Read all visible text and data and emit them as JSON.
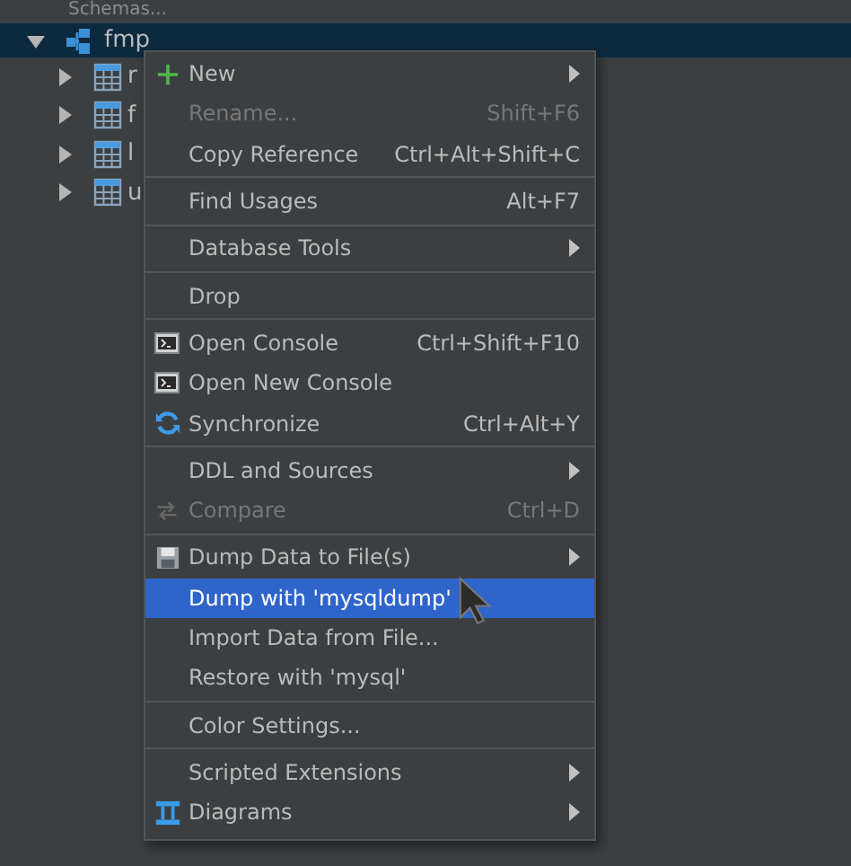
{
  "tree": {
    "header": "Schemas...",
    "node": {
      "label": "fmp",
      "selected": true,
      "expanded": true,
      "children": [
        {
          "label": "r"
        },
        {
          "label": "f"
        },
        {
          "label": "l"
        },
        {
          "label": "u"
        }
      ]
    }
  },
  "menu": {
    "groups": [
      [
        {
          "label": "New",
          "kind": "plus",
          "submenu": true,
          "disabled": false,
          "selected": false
        },
        {
          "label": "Rename...",
          "shortcut": "Shift+F6",
          "disabled": true,
          "selected": false
        },
        {
          "label": "Copy Reference",
          "shortcut": "Ctrl+Alt+Shift+C",
          "disabled": false,
          "selected": false
        }
      ],
      [
        {
          "label": "Find Usages",
          "shortcut": "Alt+F7",
          "disabled": false,
          "selected": false
        }
      ],
      [
        {
          "label": "Database Tools",
          "submenu": true,
          "disabled": false,
          "selected": false
        }
      ],
      [
        {
          "label": "Drop",
          "disabled": false,
          "selected": false
        }
      ],
      [
        {
          "label": "Open Console",
          "kind": "console",
          "shortcut": "Ctrl+Shift+F10",
          "disabled": false,
          "selected": false
        },
        {
          "label": "Open New Console",
          "kind": "console",
          "disabled": false,
          "selected": false
        },
        {
          "label": "Synchronize",
          "kind": "sync",
          "shortcut": "Ctrl+Alt+Y",
          "disabled": false,
          "selected": false
        }
      ],
      [
        {
          "label": "DDL and Sources",
          "submenu": true,
          "disabled": false,
          "selected": false
        },
        {
          "label": "Compare",
          "kind": "compare",
          "shortcut": "Ctrl+D",
          "disabled": true,
          "selected": false
        }
      ],
      [
        {
          "label": "Dump Data to File(s)",
          "kind": "disk",
          "submenu": true,
          "disabled": false,
          "selected": false
        },
        {
          "label": "Dump with 'mysqldump'",
          "disabled": false,
          "selected": true
        },
        {
          "label": "Import Data from File...",
          "disabled": false,
          "selected": false
        },
        {
          "label": "Restore with 'mysql'",
          "disabled": false,
          "selected": false
        }
      ],
      [
        {
          "label": "Color Settings...",
          "disabled": false,
          "selected": false
        }
      ],
      [
        {
          "label": "Scripted Extensions",
          "submenu": true,
          "disabled": false,
          "selected": false
        },
        {
          "label": "Diagrams",
          "kind": "diagram",
          "submenu": true,
          "disabled": false,
          "selected": false
        }
      ]
    ]
  }
}
